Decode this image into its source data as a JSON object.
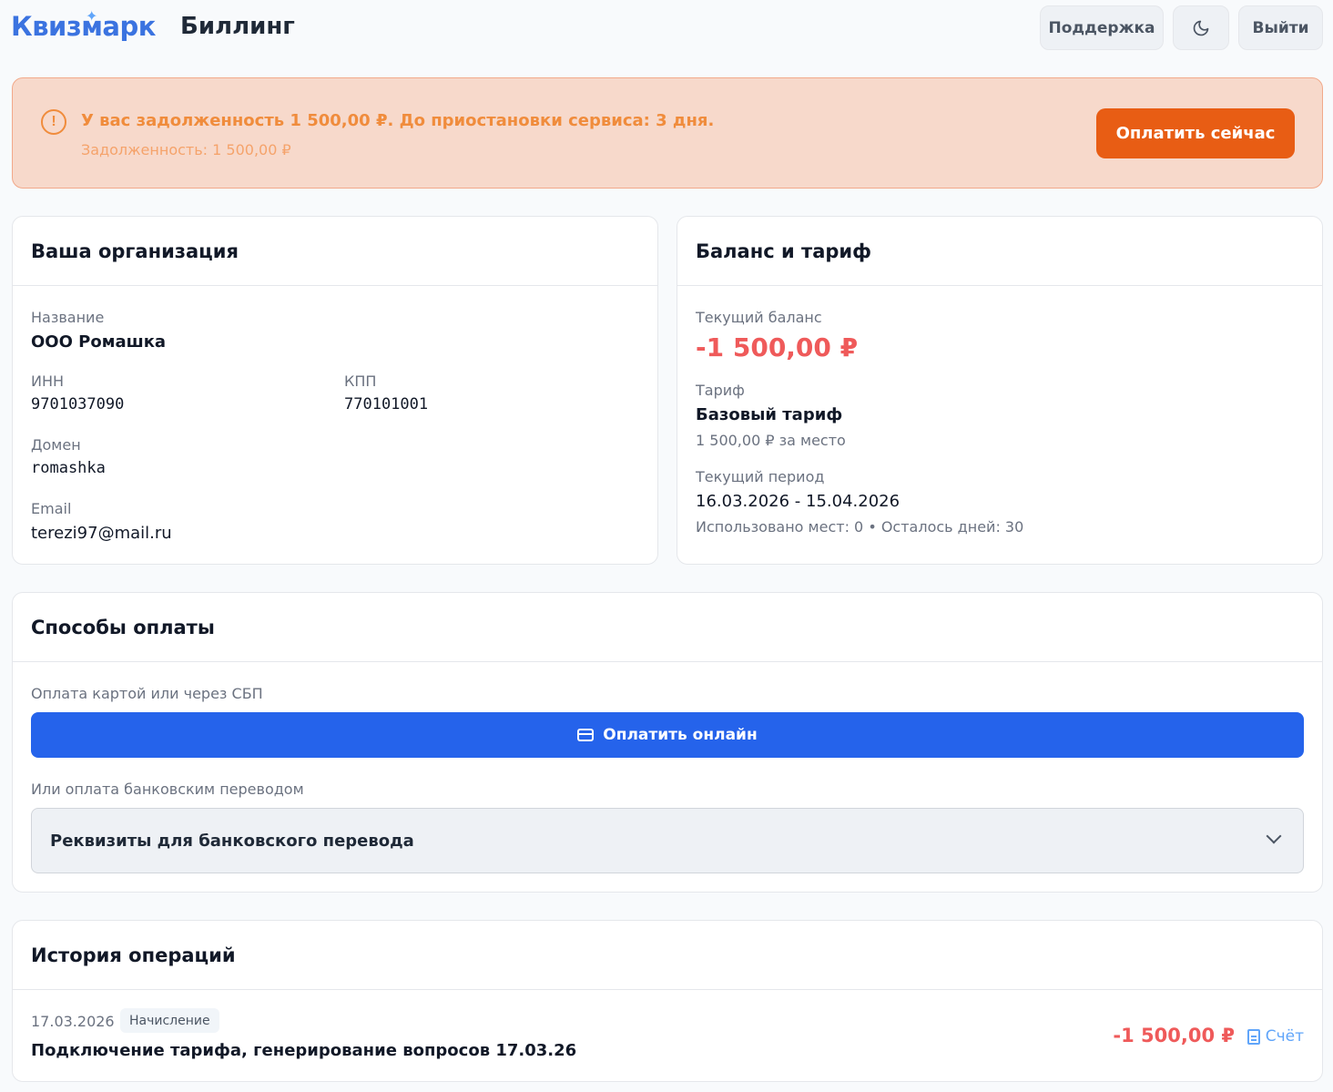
{
  "header": {
    "logo": "Квизмарк",
    "title": "Биллинг",
    "support_label": "Поддержка",
    "theme_icon": "moon-icon",
    "logout_label": "Выйти"
  },
  "alert": {
    "title": "У вас задолженность 1 500,00 ₽. До приостановки сервиса: 3 дня.",
    "subtitle": "Задолженность: 1 500,00 ₽",
    "pay_now_label": "Оплатить сейчас"
  },
  "organization": {
    "title": "Ваша организация",
    "name_label": "Название",
    "name_value": "ООО Ромашка",
    "inn_label": "ИНН",
    "inn_value": "9701037090",
    "kpp_label": "КПП",
    "kpp_value": "770101001",
    "domain_label": "Домен",
    "domain_value": "romashka",
    "email_label": "Email",
    "email_value": "terezi97@mail.ru"
  },
  "balance": {
    "title": "Баланс и тариф",
    "current_label": "Текущий баланс",
    "current_value": "-1 500,00 ₽",
    "tariff_label": "Тариф",
    "tariff_value": "Базовый тариф",
    "tariff_price": "1 500,00 ₽ за место",
    "period_label": "Текущий период",
    "period_value": "16.03.2026 - 15.04.2026",
    "usage": "Использовано мест: 0 • Осталось дней: 30"
  },
  "payment": {
    "title": "Способы оплаты",
    "online_caption": "Оплата картой или через СБП",
    "online_button": "Оплатить онлайн",
    "bank_caption": "Или оплата банковским переводом",
    "bank_accordion": "Реквизиты для банковского перевода"
  },
  "history": {
    "title": "История операций",
    "items": [
      {
        "date": "17.03.2026",
        "type": "Начисление",
        "description": "Подключение тарифа, генерирование вопросов 17.03.26",
        "amount": "-1 500,00 ₽",
        "invoice_label": "Счёт"
      }
    ]
  },
  "colors": {
    "accent": "#2563eb",
    "warning": "#e85d14",
    "negative": "#ef5a5a"
  }
}
